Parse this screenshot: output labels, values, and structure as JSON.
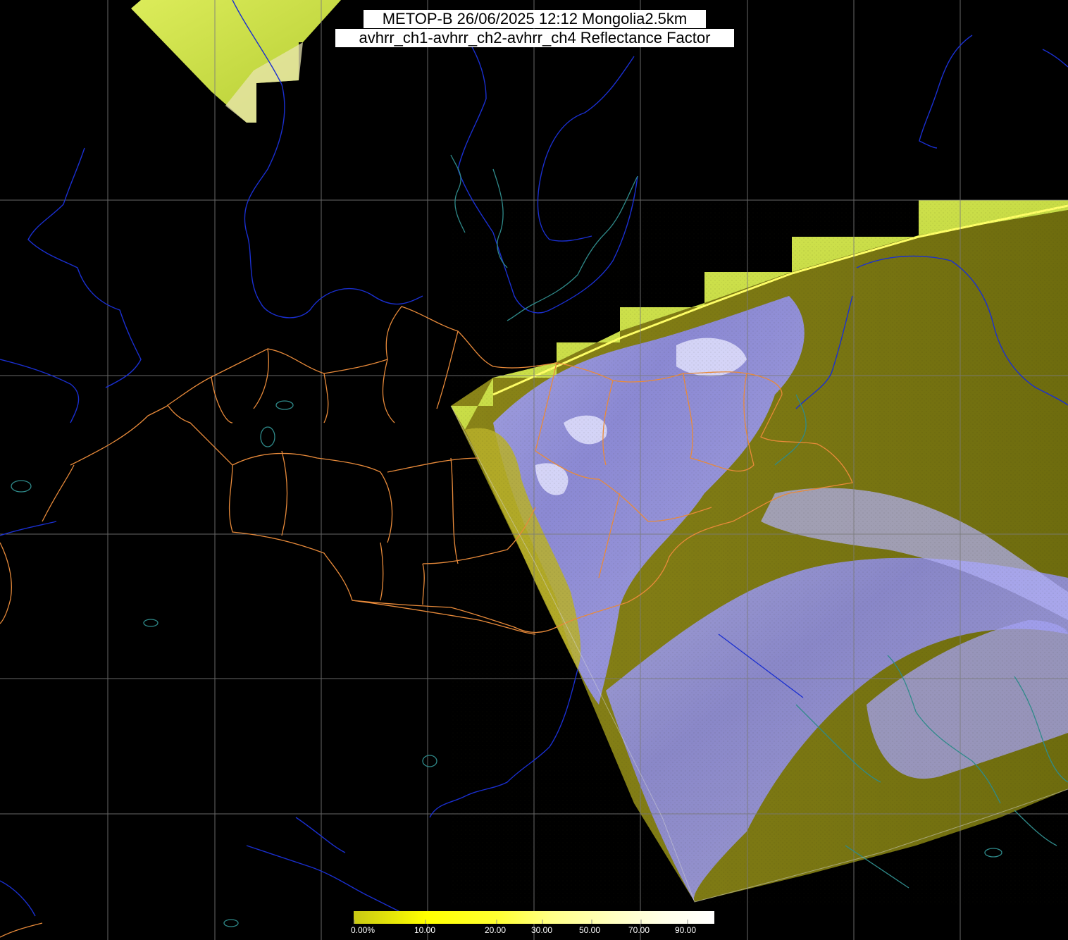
{
  "header": {
    "title_line1": "METOP-B 26/06/2025 12:12 Mongolia2.5km",
    "title_line2": "avhrr_ch1-avhrr_ch2-avhrr_ch4 Reflectance Factor"
  },
  "colorbar": {
    "labels": [
      "0.00%",
      "10.00",
      "20.00",
      "30.00",
      "50.00",
      "70.00",
      "90.00"
    ],
    "colors": [
      "#c8c814",
      "#ffff00",
      "#ffff33",
      "#ffff88",
      "#ffffc0",
      "#ffffe8",
      "#ffffff"
    ]
  },
  "colors": {
    "background": "#000000",
    "grid": "#7a7a7a",
    "rivers": "#1a2fd0",
    "borders": "#e88a3a",
    "coast": "#2f8a8a",
    "land_olive": "#7d7a12",
    "cloud_lavender": "#9a98f2",
    "swath_yellow": "#c8dc3c"
  }
}
